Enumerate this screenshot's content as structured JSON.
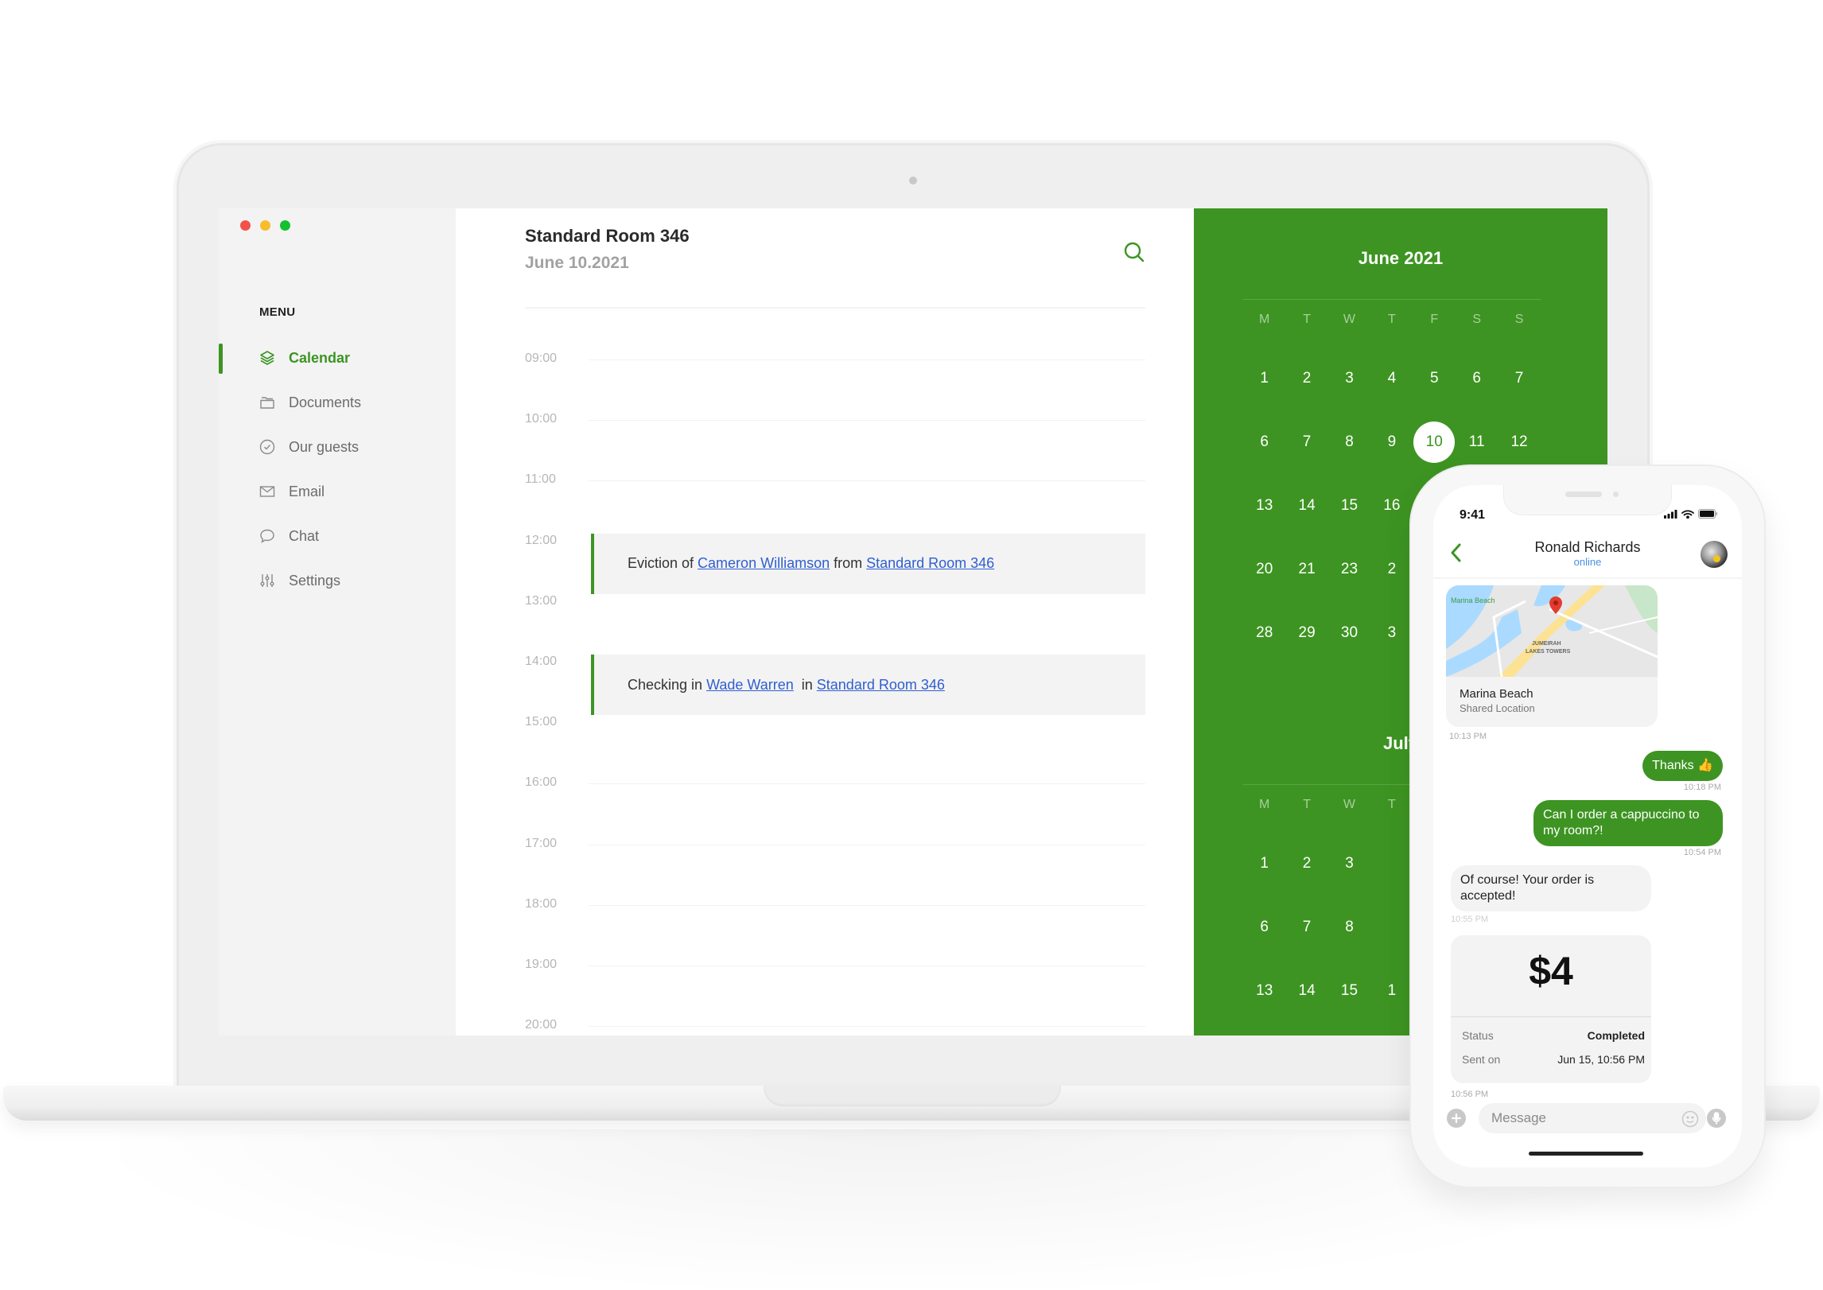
{
  "window": {
    "controls": [
      {
        "name": "close",
        "color": "#f2524a"
      },
      {
        "name": "minimize",
        "color": "#f7bd2b"
      },
      {
        "name": "maximize",
        "color": "#14c12e"
      }
    ]
  },
  "theme": {
    "accent": "#3d9422",
    "link": "#2f5fd0",
    "online": "#4a90e2"
  },
  "sidebar": {
    "menu_label": "MENU",
    "items": [
      {
        "label": "Calendar",
        "icon": "layers-icon",
        "active": true
      },
      {
        "label": "Documents",
        "icon": "folder-icon",
        "active": false
      },
      {
        "label": "Our guests",
        "icon": "check-circle-icon",
        "active": false
      },
      {
        "label": "Email",
        "icon": "mail-icon",
        "active": false
      },
      {
        "label": "Chat",
        "icon": "chat-bubble-icon",
        "active": false
      },
      {
        "label": "Settings",
        "icon": "sliders-icon",
        "active": false
      }
    ]
  },
  "dayview": {
    "title": "Standard Room 346",
    "date": "June 10.2021",
    "search_icon": "search-icon",
    "times": [
      "09:00",
      "10:00",
      "11:00",
      "12:00",
      "13:00",
      "14:00",
      "15:00",
      "16:00",
      "17:00",
      "18:00",
      "19:00",
      "20:00"
    ],
    "events": [
      {
        "start": "12:00",
        "end": "13:00",
        "parts": [
          {
            "text": "Eviction of",
            "link": false
          },
          {
            "text": "Cameron Williamson",
            "link": true
          },
          {
            "text": "from",
            "link": false
          },
          {
            "text": "Standard Room 346",
            "link": true
          }
        ]
      },
      {
        "start": "14:00",
        "end": "15:00",
        "parts": [
          {
            "text": "Checking in",
            "link": false
          },
          {
            "text": "Wade Warren",
            "link": true
          },
          {
            "text": " in",
            "link": false
          },
          {
            "text": "Standard Room 346",
            "link": true
          }
        ]
      }
    ]
  },
  "calendar": {
    "weekdays": [
      "M",
      "T",
      "W",
      "T",
      "F",
      "S",
      "S"
    ],
    "months": [
      {
        "title": "June 2021",
        "weeks": [
          [
            "1",
            "2",
            "3",
            "4",
            "5",
            "6",
            "7"
          ],
          [
            "6",
            "7",
            "8",
            "9",
            "10",
            "11",
            "12"
          ],
          [
            "13",
            "14",
            "15",
            "16",
            "",
            "",
            ""
          ],
          [
            "20",
            "21",
            "23",
            "2",
            "",
            "",
            ""
          ],
          [
            "28",
            "29",
            "30",
            "3",
            "",
            "",
            ""
          ]
        ],
        "selected": "10"
      },
      {
        "title": "July",
        "weeks": [
          [
            "1",
            "2",
            "3",
            "",
            "",
            "",
            ""
          ],
          [
            "6",
            "7",
            "8",
            "",
            "",
            "",
            ""
          ],
          [
            "13",
            "14",
            "15",
            "1",
            "",
            "",
            ""
          ]
        ]
      }
    ]
  },
  "phone": {
    "status_time": "9:41",
    "contact": {
      "name": "Ronald Richards",
      "status": "online"
    },
    "location": {
      "title": "Marina Beach",
      "subtitle": "Shared Location",
      "map_label_1": "Marina Beach",
      "map_label_2": "JUMEIRAH",
      "map_label_3": "LAKES TOWERS",
      "time": "10:13 PM"
    },
    "messages": [
      {
        "dir": "out",
        "text": "Thanks 👍",
        "time": "10:18 PM"
      },
      {
        "dir": "out",
        "text": "Can I order a cappuccino to my room?!",
        "time": "10:54 PM"
      },
      {
        "dir": "in",
        "text": "Of course! Your order is accepted!",
        "time": "10:55 PM"
      }
    ],
    "payment": {
      "amount": "$4",
      "status_label": "Status",
      "status_value": "Completed",
      "sent_label": "Sent on",
      "sent_value": "Jun 15, 10:56 PM",
      "time": "10:56 PM"
    },
    "composer": {
      "placeholder": "Message"
    }
  }
}
